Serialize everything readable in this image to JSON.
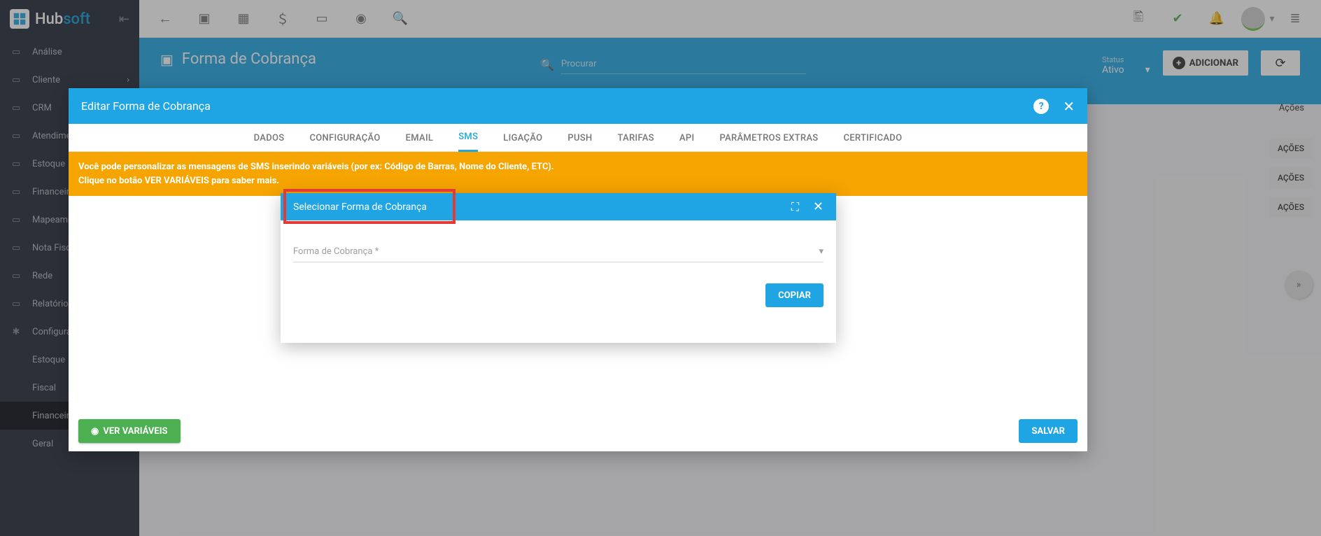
{
  "brand": {
    "name_a": "Hub",
    "name_b": "soft"
  },
  "sidebar": {
    "items": [
      {
        "label": "Análise"
      },
      {
        "label": "Cliente"
      },
      {
        "label": "CRM"
      },
      {
        "label": "Atendimento"
      },
      {
        "label": "Estoque"
      },
      {
        "label": "Financeiro"
      },
      {
        "label": "Mapeamento"
      },
      {
        "label": "Nota Fiscal"
      },
      {
        "label": "Rede"
      },
      {
        "label": "Relatórios"
      },
      {
        "label": "Configurações"
      }
    ],
    "subitems": [
      {
        "label": "Estoque"
      },
      {
        "label": "Fiscal"
      },
      {
        "label": "Financeiro",
        "active": true
      },
      {
        "label": "Geral"
      }
    ]
  },
  "page": {
    "title": "Forma de Cobrança",
    "search_placeholder": "Procurar",
    "status_label": "Status",
    "status_value": "Ativo",
    "add_button": "ADICIONAR",
    "acoes_label": "Ações",
    "acoes_tag": "AÇÕES"
  },
  "dialog1": {
    "title": "Editar Forma de Cobrança",
    "tabs": [
      "DADOS",
      "CONFIGURAÇÃO",
      "EMAIL",
      "SMS",
      "LIGAÇÃO",
      "PUSH",
      "TARIFAS",
      "API",
      "PARÂMETROS EXTRAS",
      "CERTIFICADO"
    ],
    "active_tab": "SMS",
    "alert_line1": "Você pode personalizar as mensagens de SMS inserindo variáveis (por ex: Código de Barras, Nome do Cliente, ETC).",
    "alert_line2": "Clique no botão VER VARIÁVEIS para saber mais.",
    "ver_variaveis": "VER VARIÁVEIS",
    "save": "SALVAR"
  },
  "dialog2": {
    "title": "Selecionar Forma de Cobrança",
    "field_label": "Forma de Cobrança *",
    "copy": "COPIAR"
  }
}
